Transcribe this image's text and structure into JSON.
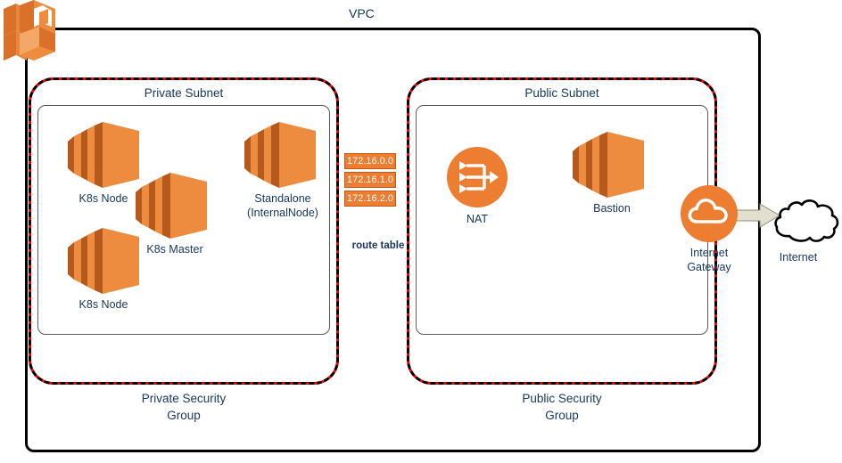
{
  "diagram": {
    "title": "VPC",
    "vpc_label": "VPC"
  },
  "private_zone": {
    "subnet_title": "Private Subnet",
    "security_group_line1": "Private Security",
    "security_group_line2": "Group",
    "instances": [
      {
        "name": "K8s Node",
        "icon": "ec2-instances-icon"
      },
      {
        "name": "K8s Master",
        "icon": "ec2-instances-icon"
      },
      {
        "name": "K8s Node",
        "icon": "ec2-instances-icon"
      },
      {
        "name": "Standalone",
        "name_line2": "(InternalNode)",
        "icon": "ec2-instances-icon"
      }
    ]
  },
  "public_zone": {
    "subnet_title": "Public Subnet",
    "security_group_line1": "Public Security",
    "security_group_line2": "Group",
    "nat": {
      "name": "NAT",
      "icon": "nat-gateway-icon"
    },
    "bastion": {
      "name": "Bastion",
      "icon": "ec2-instances-icon"
    }
  },
  "route_table": {
    "label": "route table",
    "entries": [
      "172.16.0.0",
      "172.16.1.0",
      "172.16.2.0"
    ]
  },
  "gateway": {
    "name_line1": "Internet",
    "name_line2": "Gateway",
    "icon": "internet-gateway-cloud-icon"
  },
  "internet": {
    "label": "Internet",
    "icon": "cloud-icon"
  },
  "colors": {
    "aws_orange": "#ED7D31",
    "aws_orange_dark": "#C15A18",
    "security_group_red": "#FF0000",
    "border_black": "#000000",
    "text_navy": "#17365D",
    "arrow_fill": "#E2DFCF"
  }
}
